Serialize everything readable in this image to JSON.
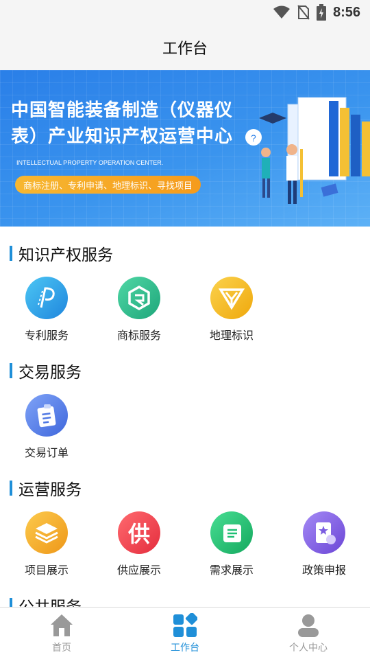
{
  "status_bar": {
    "time": "8:56"
  },
  "header": {
    "title": "工作台"
  },
  "banner": {
    "headline": "中国智能装备制造（仪器仪表）产业知识产权运营中心",
    "subtitle_en": "INTELLECTUAL PROPERTY OPERATION CENTER.",
    "tags": "商标注册、专利申请、地理标识、寻找项目"
  },
  "sections": [
    {
      "title": "知识产权服务",
      "items": [
        {
          "label": "专利服务",
          "icon": "patent-icon",
          "color": "#2aa3e8"
        },
        {
          "label": "商标服务",
          "icon": "trademark-icon",
          "color": "#2ab98a"
        },
        {
          "label": "地理标识",
          "icon": "geo-mark-icon",
          "color": "#f3b40f"
        }
      ]
    },
    {
      "title": "交易服务",
      "items": [
        {
          "label": "交易订单",
          "icon": "order-icon",
          "color": "#4f78e3"
        }
      ]
    },
    {
      "title": "运营服务",
      "items": [
        {
          "label": "项目展示",
          "icon": "project-icon",
          "color": "#f1a626"
        },
        {
          "label": "供应展示",
          "icon": "supply-icon",
          "color": "#f0434f",
          "glyph": "供"
        },
        {
          "label": "需求展示",
          "icon": "demand-icon",
          "color": "#1fbf74"
        },
        {
          "label": "政策申报",
          "icon": "policy-icon",
          "color": "#7b5ce0"
        }
      ]
    },
    {
      "title": "公共服务",
      "items": []
    }
  ],
  "tab_bar": {
    "tabs": [
      {
        "label": "首页",
        "icon": "home-icon",
        "active": false
      },
      {
        "label": "工作台",
        "icon": "workbench-icon",
        "active": true
      },
      {
        "label": "个人中心",
        "icon": "person-icon",
        "active": false
      }
    ]
  },
  "colors": {
    "accent": "#1f8fd8",
    "inactive": "#999999"
  }
}
